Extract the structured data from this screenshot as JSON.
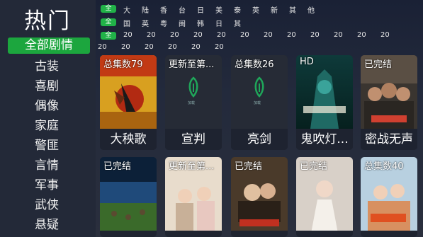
{
  "sidebar": {
    "title": "热门",
    "active": "全部剧情",
    "items": [
      "古装",
      "喜剧",
      "偶像",
      "家庭",
      "警匪",
      "言情",
      "军事",
      "武侠",
      "悬疑"
    ]
  },
  "filters": {
    "row1": {
      "chip": "全",
      "options": [
        "大",
        "陆",
        "香",
        "台",
        "日",
        "美",
        "泰",
        "英",
        "新",
        "其",
        "他"
      ]
    },
    "row2": {
      "chip": "全",
      "options": [
        "国",
        "英",
        "粤",
        "闽",
        "韩",
        "日",
        "其"
      ]
    },
    "row3": {
      "chip": "全",
      "options": [
        "20",
        "20",
        "20",
        "20",
        "20",
        "20",
        "20",
        "20",
        "20",
        "20",
        "20",
        "20"
      ]
    },
    "row4": {
      "options": [
        "20",
        "20",
        "20",
        "20",
        "20",
        "20"
      ]
    }
  },
  "cards_row1": [
    {
      "badge": "总集数79",
      "title": "大秧歌"
    },
    {
      "badge": "更新至第...",
      "title": "宣判"
    },
    {
      "badge": "总集数26",
      "title": "亮剑"
    },
    {
      "badge": "HD",
      "title": "鬼吹灯..."
    },
    {
      "badge": "已完结",
      "title": "密战无声"
    }
  ],
  "cards_row2": [
    {
      "badge": "已完结",
      "title": ""
    },
    {
      "badge": "更新至第...",
      "title": ""
    },
    {
      "badge": "已完结",
      "title": ""
    },
    {
      "badge": "已完结",
      "title": ""
    },
    {
      "badge": "总集数40",
      "title": ""
    }
  ],
  "placeholder_text": "加载",
  "colors": {
    "accent": "#1ca63e"
  }
}
